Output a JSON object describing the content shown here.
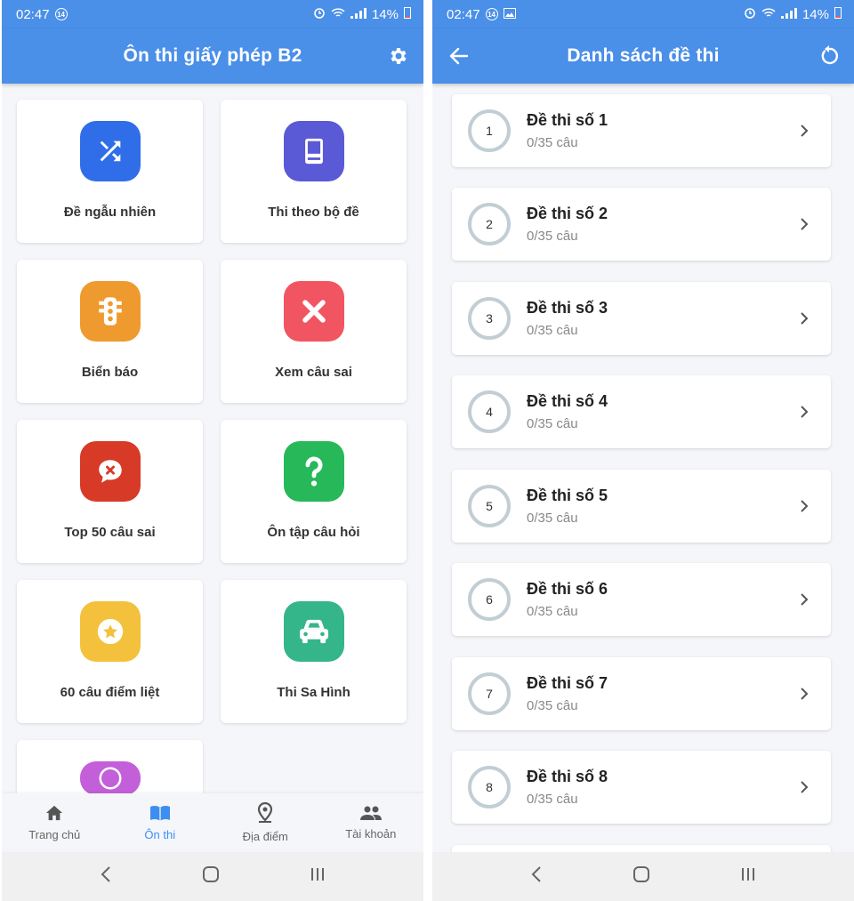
{
  "left": {
    "status": {
      "time": "02:47",
      "notif": "14",
      "battery": "14%"
    },
    "appbar": {
      "title": "Ôn thi giấy phép B2",
      "settings_icon": "gear-icon"
    },
    "tiles": [
      {
        "label": "Đề ngẫu nhiên",
        "icon": "shuffle-icon",
        "color": "#2f6ee8"
      },
      {
        "label": "Thi theo bộ đề",
        "icon": "book-icon",
        "color": "#5a59d6"
      },
      {
        "label": "Biển báo",
        "icon": "traffic-light-icon",
        "color": "#ef9a2f"
      },
      {
        "label": "Xem câu sai",
        "icon": "close-icon",
        "color": "#f25562"
      },
      {
        "label": "Top 50 câu sai",
        "icon": "chat-error-icon",
        "color": "#d73a27"
      },
      {
        "label": "Ôn tập câu hỏi",
        "icon": "question-icon",
        "color": "#27b85a"
      },
      {
        "label": "60 câu điểm liệt",
        "icon": "star-icon",
        "color": "#f3c13c"
      },
      {
        "label": "Thi Sa Hình",
        "icon": "car-icon",
        "color": "#35b58a"
      },
      {
        "label": "",
        "icon": "info-icon",
        "color": "#c35fd9"
      }
    ],
    "nav": [
      {
        "label": "Trang chủ",
        "icon": "home-icon"
      },
      {
        "label": "Ôn thi",
        "icon": "book-open-icon"
      },
      {
        "label": "Địa điểm",
        "icon": "map-pin-icon"
      },
      {
        "label": "Tài khoản",
        "icon": "people-icon"
      }
    ]
  },
  "right": {
    "status": {
      "time": "02:47",
      "notif": "14",
      "battery": "14%"
    },
    "appbar": {
      "title": "Danh sách đề thi",
      "back_icon": "arrow-left-icon",
      "refresh_icon": "refresh-icon"
    },
    "exams": [
      {
        "num": "1",
        "title": "Đề thi số 1",
        "progress": "0/35 câu"
      },
      {
        "num": "2",
        "title": "Đề thi số 2",
        "progress": "0/35 câu"
      },
      {
        "num": "3",
        "title": "Đề thi số 3",
        "progress": "0/35 câu"
      },
      {
        "num": "4",
        "title": "Đề thi số 4",
        "progress": "0/35 câu"
      },
      {
        "num": "5",
        "title": "Đề thi số 5",
        "progress": "0/35 câu"
      },
      {
        "num": "6",
        "title": "Đề thi số 6",
        "progress": "0/35 câu"
      },
      {
        "num": "7",
        "title": "Đề thi số 7",
        "progress": "0/35 câu"
      },
      {
        "num": "8",
        "title": "Đề thi số 8",
        "progress": "0/35 câu"
      }
    ]
  }
}
